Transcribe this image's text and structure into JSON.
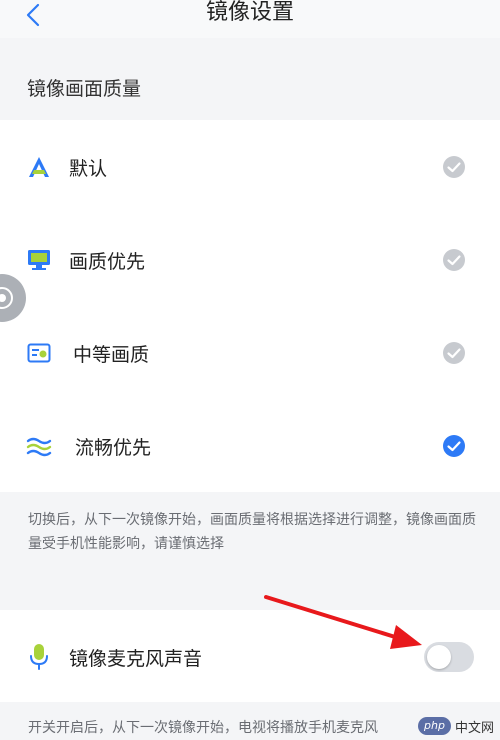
{
  "header": {
    "title": "镜像设置"
  },
  "quality_section": {
    "heading": "镜像画面质量",
    "options": [
      {
        "label": "默认",
        "icon": "letter-a-icon",
        "selected": false
      },
      {
        "label": "画质优先",
        "icon": "monitor-icon",
        "selected": false
      },
      {
        "label": "中等画质",
        "icon": "picture-card-icon",
        "selected": false
      },
      {
        "label": "流畅优先",
        "icon": "waves-icon",
        "selected": true
      }
    ],
    "note": "切换后，从下一次镜像开始，画面质量将根据选择进行调整，镜像画面质量受手机性能影响，请谨慎选择"
  },
  "mic_section": {
    "label": "镜像麦克风声音",
    "toggle_on": false,
    "note": "开关开启后，从下一次镜像开始，电视将播放手机麦克风"
  },
  "watermark": {
    "logo_text": "php",
    "site_text": "中文网"
  },
  "colors": {
    "accent": "#2d7af6",
    "unchecked": "#c7cacf",
    "icon_green": "#a8d23a",
    "toggle_off": "#d9dce1",
    "arrow": "#e8191c"
  }
}
